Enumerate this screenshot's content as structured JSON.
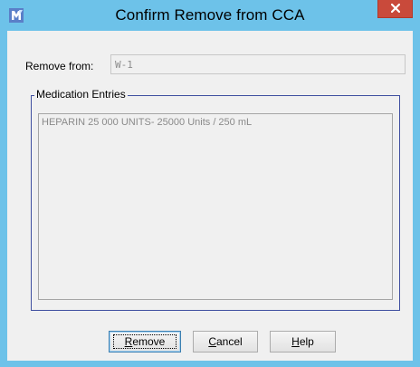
{
  "window": {
    "title": "Confirm Remove from CCA",
    "close_glyph": "x",
    "app_icon": "app-logo-icon"
  },
  "form": {
    "remove_from_label": "Remove from:",
    "remove_from_value": "W-1"
  },
  "medication_entries": {
    "legend": "Medication Entries",
    "items": [
      "HEPARIN 25 000 UNITS- 25000 Units / 250 mL"
    ]
  },
  "buttons": {
    "remove_pre": "",
    "remove_mnemonic": "R",
    "remove_post": "emove",
    "cancel_pre": "",
    "cancel_mnemonic": "C",
    "cancel_post": "ancel",
    "help_pre": "",
    "help_mnemonic": "H",
    "help_post": "elp"
  },
  "colors": {
    "frame": "#6dc2e9",
    "close_button": "#c94a3b",
    "client_bg": "#f0f0f0",
    "group_border": "#3f4fa0",
    "disabled_text": "#8a8a8a"
  }
}
